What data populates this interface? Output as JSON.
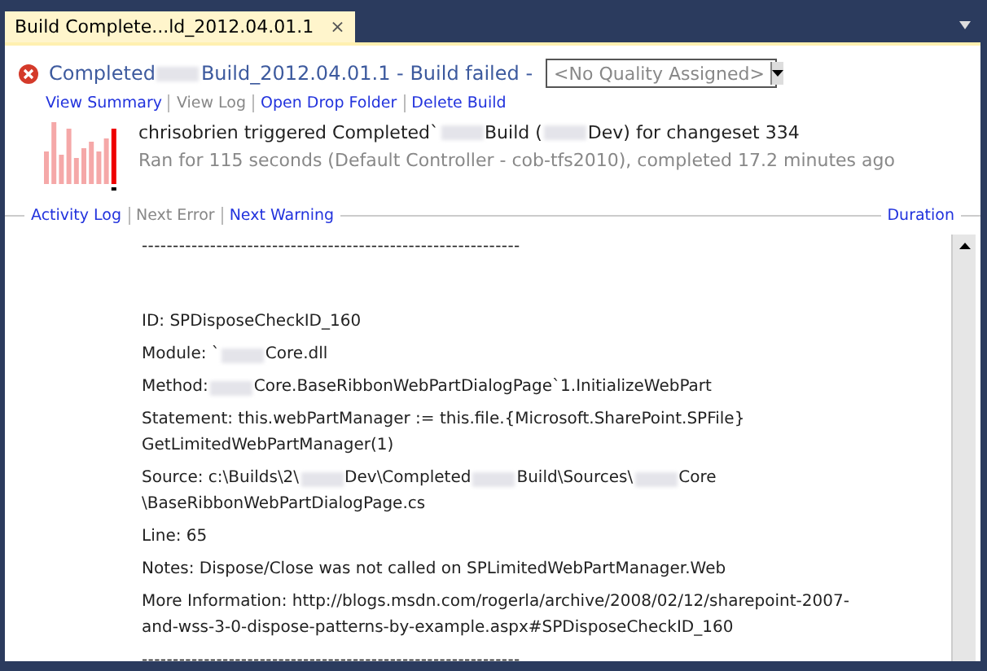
{
  "tab": {
    "title": "Build Complete...ld_2012.04.01.1",
    "close": "×",
    "selected": true
  },
  "header": {
    "failed": true,
    "title_parts": [
      "Completed",
      "Build_2012.04.01.1 - Build failed -"
    ],
    "quality": {
      "placeholder": "<No Quality Assigned>"
    }
  },
  "links": [
    {
      "label": "View Summary",
      "disabled": false
    },
    {
      "label": "View Log",
      "disabled": true
    },
    {
      "label": "Open Drop Folder",
      "disabled": false
    },
    {
      "label": "Delete Build",
      "disabled": false
    }
  ],
  "summary": {
    "triggered_parts": [
      "chrisobrien triggered Completed`",
      "Build (",
      "Dev) for changeset 334"
    ],
    "ran": "Ran for 115 seconds (Default Controller - cob-tfs2010), completed 17.2 minutes ago"
  },
  "log_nav": [
    {
      "label": "Activity Log",
      "disabled": false
    },
    {
      "label": "Next Error",
      "disabled": true
    },
    {
      "label": "Next Warning",
      "disabled": false
    }
  ],
  "duration_label": "Duration",
  "log_lines": [
    {
      "kind": "rule",
      "lines": [
        [
          "-------------------------------------------------------------"
        ]
      ]
    },
    {
      "kind": "field",
      "lines": [
        [
          "ID: SPDisposeCheckID_160"
        ]
      ]
    },
    {
      "kind": "field",
      "lines": [
        [
          "Module: `",
          "Core.dll"
        ]
      ]
    },
    {
      "kind": "field",
      "lines": [
        [
          "Method: ",
          "Core.BaseRibbonWebPartDialogPage`1.InitializeWebPart"
        ]
      ]
    },
    {
      "kind": "field",
      "lines": [
        [
          "Statement: this.webPartManager := this.file.{Microsoft.SharePoint.SPFile}"
        ],
        [
          "GetLimitedWebPartManager(1)"
        ]
      ]
    },
    {
      "kind": "field",
      "lines": [
        [
          "Source: c:\\Builds\\2\\",
          "Dev\\Completed",
          "Build\\Sources\\",
          "Core"
        ],
        [
          "\\BaseRibbonWebPartDialogPage.cs"
        ]
      ]
    },
    {
      "kind": "field",
      "lines": [
        [
          "Line: 65"
        ]
      ]
    },
    {
      "kind": "field",
      "lines": [
        [
          "Notes: Dispose/Close was not called on SPLimitedWebPartManager.Web"
        ]
      ]
    },
    {
      "kind": "field",
      "lines": [
        [
          "More Information: http://blogs.msdn.com/rogerla/archive/2008/02/12/sharepoint-2007-"
        ],
        [
          "and-wss-3-0-dispose-patterns-by-example.aspx#SPDisposeCheckID_160"
        ]
      ]
    },
    {
      "kind": "rule",
      "lines": [
        [
          "-------------------------------------------------------------"
        ]
      ]
    }
  ]
}
